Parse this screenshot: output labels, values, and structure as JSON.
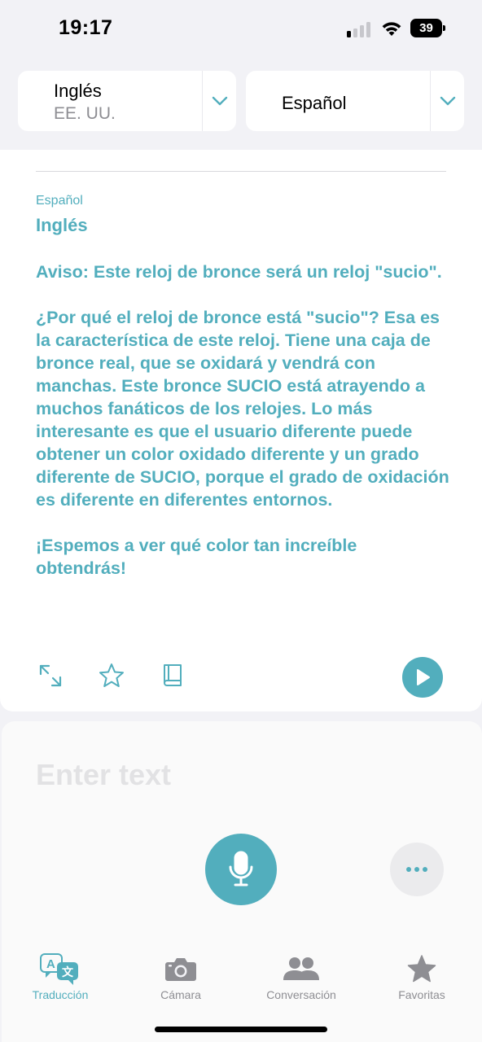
{
  "status_bar": {
    "time": "19:17",
    "battery_level": "39",
    "signal_bars_active": 1,
    "signal_bars_total": 4
  },
  "language_bar": {
    "source": {
      "language": "Inglés",
      "region": "EE. UU."
    },
    "target": {
      "language": "Español"
    }
  },
  "result": {
    "label_small": "Español",
    "label_large": "Inglés",
    "text": "Aviso: Este reloj de bronce será un reloj \"sucio\".\n\n¿Por qué el reloj de bronce está \"sucio\"? Esa es la característica de este reloj. Tiene una caja de bronce real, que se oxidará y vendrá con manchas. Este bronce SUCIO está atrayendo a muchos fanáticos de los relojes. Lo más interesante es que el usuario diferente puede obtener un color oxidado diferente y un grado diferente de SUCIO, porque el grado de oxidación es diferente en diferentes entornos.\n\n¡Espemos a ver qué color tan increíble obtendrás!",
    "actions": [
      "expand-icon",
      "star-icon",
      "book-icon",
      "play-icon"
    ]
  },
  "input": {
    "placeholder": "Enter text",
    "value": ""
  },
  "tabs": [
    {
      "label": "Traducción",
      "icon": "translate-icon",
      "active": true
    },
    {
      "label": "Cámara",
      "icon": "camera-icon",
      "active": false
    },
    {
      "label": "Conversación",
      "icon": "conversation-icon",
      "active": false
    },
    {
      "label": "Favoritas",
      "icon": "star-filled-icon",
      "active": false
    }
  ],
  "colors": {
    "accent": "#52aebd",
    "background": "#f2f2f6",
    "inactive": "#8e8e93"
  }
}
